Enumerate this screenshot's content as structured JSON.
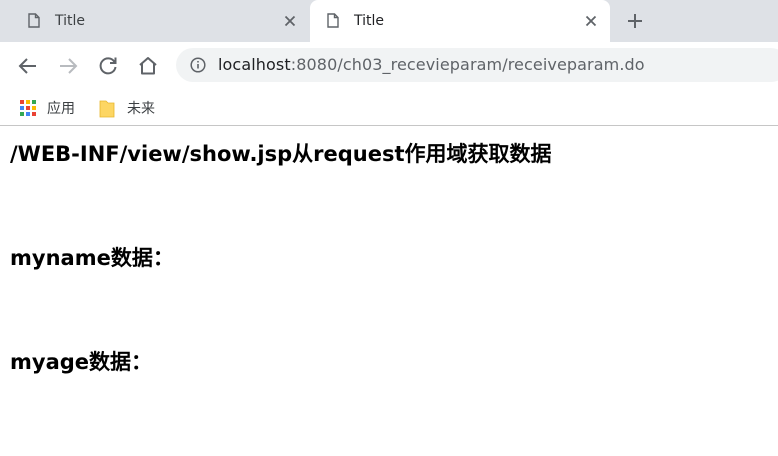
{
  "tabs": [
    {
      "title": "Title",
      "active": false
    },
    {
      "title": "Title",
      "active": true
    }
  ],
  "address_bar": {
    "host": "localhost",
    "path": ":8080/ch03_recevieparam/receiveparam.do"
  },
  "bookmarks": [
    {
      "label": "应用",
      "icon": "apps-grid-icon"
    },
    {
      "label": "未来",
      "icon": "folder-icon"
    }
  ],
  "content": {
    "title": "/WEB-INF/view/show.jsp从request作用域获取数据",
    "myname_label": "myname数据：",
    "myage_label": "myage数据："
  },
  "colors": {
    "tabstrip_bg": "#dee1e6",
    "omnibox_bg": "#f1f3f4",
    "folder_yellow": "#fdd663"
  }
}
